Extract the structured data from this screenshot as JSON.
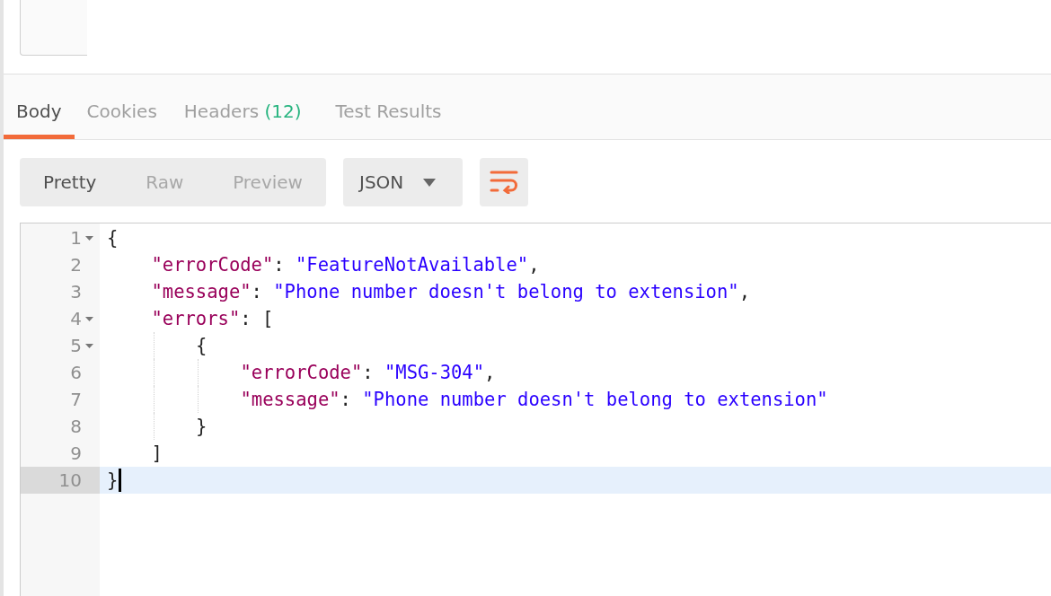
{
  "response_tabs": [
    {
      "label": "Body",
      "selected": true
    },
    {
      "label": "Cookies",
      "selected": false
    },
    {
      "label": "Headers",
      "count": "(12)",
      "selected": false
    },
    {
      "label": "Test Results",
      "selected": false
    }
  ],
  "view_modes": [
    {
      "label": "Pretty",
      "selected": true
    },
    {
      "label": "Raw",
      "selected": false
    },
    {
      "label": "Preview",
      "selected": false
    }
  ],
  "format_dropdown": {
    "value": "JSON"
  },
  "editor": {
    "lines": [
      {
        "number": "1",
        "foldable": true,
        "active": false,
        "tokens": [
          {
            "kind": "open",
            "text": "{"
          }
        ]
      },
      {
        "number": "2",
        "foldable": false,
        "active": false,
        "tokens": [
          {
            "kind": "key",
            "text": "\"errorCode\""
          },
          {
            "kind": "punct",
            "text": ": "
          },
          {
            "kind": "string",
            "text": "\"FeatureNotAvailable\""
          },
          {
            "kind": "punct",
            "text": ","
          }
        ]
      },
      {
        "number": "3",
        "foldable": false,
        "active": false,
        "tokens": [
          {
            "kind": "key",
            "text": "\"message\""
          },
          {
            "kind": "punct",
            "text": ": "
          },
          {
            "kind": "string",
            "text": "\"Phone number doesn't belong to extension\""
          },
          {
            "kind": "punct",
            "text": ","
          }
        ]
      },
      {
        "number": "4",
        "foldable": true,
        "active": false,
        "tokens": [
          {
            "kind": "key",
            "text": "\"errors\""
          },
          {
            "kind": "punct",
            "text": ": "
          },
          {
            "kind": "open",
            "text": "["
          }
        ]
      },
      {
        "number": "5",
        "foldable": true,
        "active": false,
        "tokens": [
          {
            "kind": "open",
            "text": "{"
          }
        ]
      },
      {
        "number": "6",
        "foldable": false,
        "active": false,
        "tokens": [
          {
            "kind": "key",
            "text": "\"errorCode\""
          },
          {
            "kind": "punct",
            "text": ": "
          },
          {
            "kind": "string",
            "text": "\"MSG-304\""
          },
          {
            "kind": "punct",
            "text": ","
          }
        ]
      },
      {
        "number": "7",
        "foldable": false,
        "active": false,
        "tokens": [
          {
            "kind": "key",
            "text": "\"message\""
          },
          {
            "kind": "punct",
            "text": ": "
          },
          {
            "kind": "string",
            "text": "\"Phone number doesn't belong to extension\""
          }
        ]
      },
      {
        "number": "8",
        "foldable": false,
        "active": false,
        "tokens": [
          {
            "kind": "close",
            "text": "}"
          }
        ]
      },
      {
        "number": "9",
        "foldable": false,
        "active": false,
        "tokens": [
          {
            "kind": "close",
            "text": "]"
          }
        ]
      },
      {
        "number": "10",
        "foldable": false,
        "active": true,
        "tokens": [
          {
            "kind": "close",
            "text": "}"
          }
        ]
      }
    ]
  }
}
